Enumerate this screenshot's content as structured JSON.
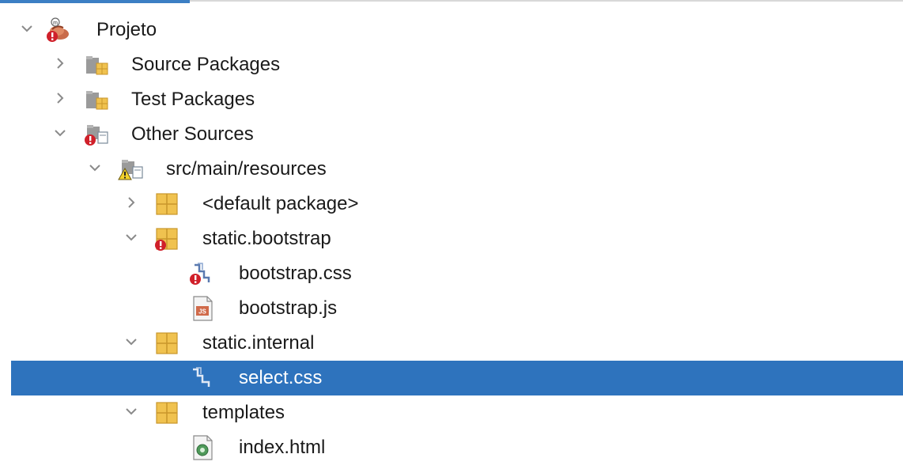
{
  "tree": {
    "project": {
      "label": "Projeto",
      "icon": "maven-project-error-icon",
      "state": "expanded"
    },
    "source_packages": {
      "label": "Source Packages",
      "icon": "source-packages-folder-icon",
      "state": "collapsed"
    },
    "test_packages": {
      "label": "Test Packages",
      "icon": "test-packages-folder-icon",
      "state": "collapsed"
    },
    "other_sources": {
      "label": "Other Sources",
      "icon": "other-sources-folder-error-icon",
      "state": "expanded"
    },
    "src_main_resources": {
      "label": "src/main/resources",
      "icon": "resources-folder-warning-icon",
      "state": "expanded"
    },
    "default_package": {
      "label": "<default package>",
      "icon": "package-icon",
      "state": "collapsed"
    },
    "static_bootstrap": {
      "label": "static.bootstrap",
      "icon": "package-error-icon",
      "state": "expanded"
    },
    "bootstrap_css": {
      "label": "bootstrap.css",
      "icon": "css-file-error-icon"
    },
    "bootstrap_js": {
      "label": "bootstrap.js",
      "icon": "js-file-icon"
    },
    "static_internal": {
      "label": "static.internal",
      "icon": "package-icon",
      "state": "expanded"
    },
    "select_css": {
      "label": "select.css",
      "icon": "css-file-icon",
      "selected": true
    },
    "templates": {
      "label": "templates",
      "icon": "package-icon",
      "state": "expanded"
    },
    "index_html": {
      "label": "index.html",
      "icon": "html-file-icon"
    }
  },
  "colors": {
    "selection": "#2e73bd",
    "accent": "#3c7fc4",
    "package": "#f0c24f",
    "error": "#d0202a"
  }
}
